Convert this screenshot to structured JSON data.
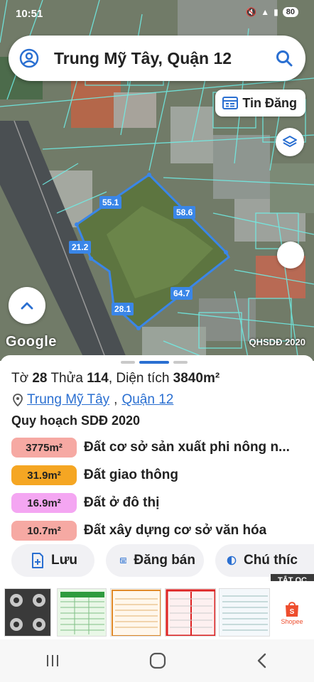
{
  "status_bar": {
    "time": "10:51",
    "battery": "80"
  },
  "search": {
    "query": "Trung Mỹ Tây, Quận 12"
  },
  "map": {
    "tin_dang_label": "Tin Đăng",
    "google_logo": "Google",
    "layer_label": "QHSDĐ 2020",
    "dimensions": [
      "55.1",
      "58.6",
      "21.2",
      "28.1",
      "64.7"
    ]
  },
  "parcel": {
    "to_label": "Tờ",
    "to_value": "28",
    "thua_label": "Thửa",
    "thua_value": "114",
    "area_label": "Diện tích",
    "area_value": "3840m²",
    "ward": "Trung Mỹ Tây",
    "district": "Quận 12"
  },
  "planning": {
    "title": "Quy hoạch SDĐ 2020",
    "rows": [
      {
        "area": "3775m²",
        "label": "Đất cơ sở sản xuất phi nông n...",
        "color": "#f6a9a3"
      },
      {
        "area": "31.9m²",
        "label": "Đất giao thông",
        "color": "#f5a623"
      },
      {
        "area": "16.9m²",
        "label": "Đất ở đô thị",
        "color": "#f4a6f2"
      },
      {
        "area": "10.7m²",
        "label": "Đất xây dựng cơ sở văn hóa",
        "color": "#f6a9a3"
      }
    ]
  },
  "actions": {
    "save": "Lưu",
    "sell": "Đăng bán",
    "note": "Chú thíc"
  },
  "ads": {
    "close_label": "TẮT QC",
    "shopee_label": "Shopee"
  },
  "colors": {
    "accent": "#2a6fd1",
    "parcel_outline": "#3a86e8"
  }
}
